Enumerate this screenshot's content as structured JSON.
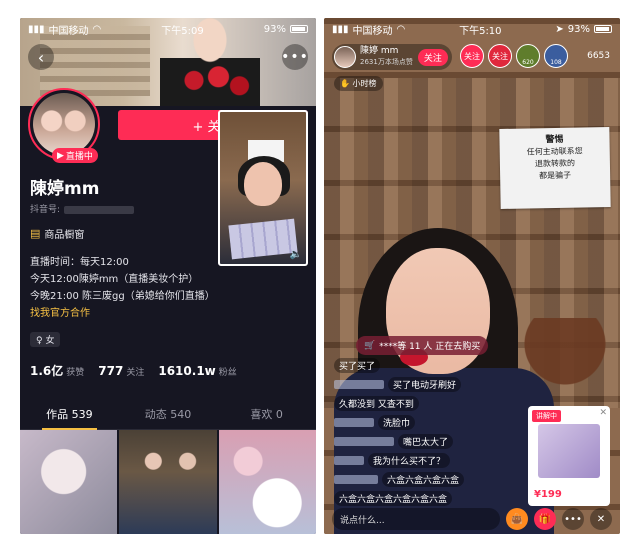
{
  "left": {
    "status": {
      "carrier": "中国移动",
      "time": "下午5:09",
      "battery": "93%"
    },
    "profile": {
      "name": "陳婷mm",
      "id_label": "抖音号:",
      "live_badge": "直播中",
      "follow_label": "+ 关注",
      "shop_label": "商品橱窗",
      "bio": [
        "直播时间：每天12:00",
        "今天12:00陳婷mm（直播美妆个护）",
        "今晚21:00 陈三废gg（弟媳给你们直播）"
      ],
      "bio_link": "找我官方合作",
      "gender": "女",
      "stats": [
        {
          "value": "1.6亿",
          "label": "获赞"
        },
        {
          "value": "777",
          "label": "关注"
        },
        {
          "value": "1610.1w",
          "label": "粉丝"
        }
      ]
    },
    "tabs": [
      {
        "label": "作品 539",
        "active": true
      },
      {
        "label": "动态 540",
        "active": false
      },
      {
        "label": "喜欢 0",
        "active": false
      }
    ]
  },
  "right": {
    "status": {
      "carrier": "中国移动",
      "time": "下午5:10",
      "battery": "93%"
    },
    "header": {
      "name": "陳婷 mm",
      "sub": "2631万本场点赞",
      "follow_label": "关注"
    },
    "viewers": [
      {
        "label": "关注"
      },
      {
        "label": "关注"
      },
      {
        "label": "620"
      },
      {
        "label": "108"
      }
    ],
    "viewer_count": "6653",
    "hour_tag": "小时榜",
    "warning": {
      "title": "警惕",
      "lines": [
        "任何主动联系您",
        "退款转款的",
        "都是骗子"
      ]
    },
    "buy_banner": "****等 11 人 正在去购买",
    "chat": [
      {
        "msg": "买了买了"
      },
      {
        "msg": "买了电动牙刷好"
      },
      {
        "msg": "久都没到  又查不到"
      },
      {
        "msg": "洗脸巾"
      },
      {
        "msg": "嘴巴太大了"
      },
      {
        "msg": "我为什么买不了？"
      },
      {
        "msg": "六盒六盒六盒六盒"
      },
      {
        "msg": "六盒六盒六盒六盒六盒六盒"
      }
    ],
    "product": {
      "tag": "讲解中",
      "price": "¥199"
    },
    "input_placeholder": "说点什么..."
  },
  "colors": {
    "accent": "#fe2c55",
    "highlight": "#f5c044",
    "panel_dark": "#161622"
  }
}
